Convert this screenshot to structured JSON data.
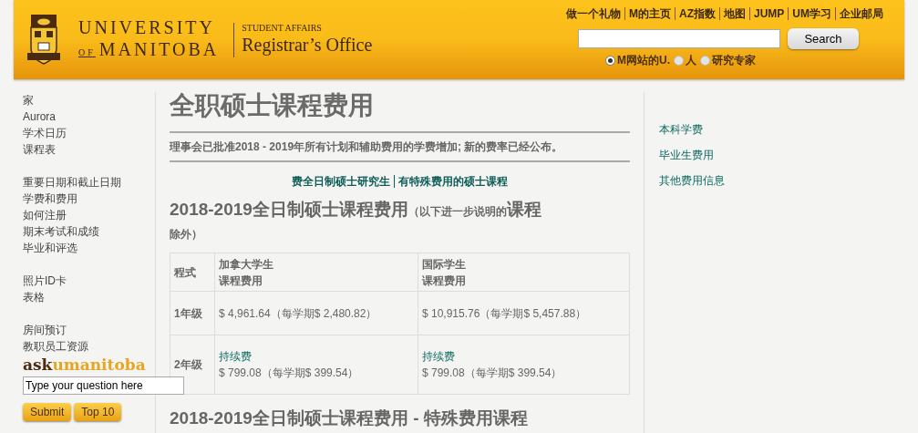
{
  "header": {
    "university_line1": "UNIVERSITY",
    "university_line2_small": "OF",
    "university_line2": "MANITOBA",
    "department": "STUDENT AFFAIRS",
    "office": "Registrar’s Office",
    "top_links": [
      "做一个礼物",
      "M的主页",
      "AZ指数",
      "地图",
      "JUMP",
      "UM学习",
      "企业邮局"
    ],
    "search_button": "Search",
    "search_scopes": [
      {
        "label": "M网站的U.",
        "selected": true
      },
      {
        "label": "人",
        "selected": false
      },
      {
        "label": "研究专家",
        "selected": false
      }
    ]
  },
  "sidebar": {
    "groups": [
      [
        "家",
        "Aurora",
        "学术日历",
        "课程表"
      ],
      [
        "重要日期和截止日期",
        "学费和费用",
        "如何注册",
        "期末考试和成绩",
        "毕业和评选"
      ],
      [
        "照片ID卡",
        "表格"
      ],
      [
        "房间预订",
        "教职员工资源"
      ]
    ],
    "ask_logo": {
      "part1": "ask",
      "part2": "umanitoba"
    },
    "question_field": {
      "value": "Type your question here"
    },
    "buttons": [
      "Submit",
      "Top 10"
    ]
  },
  "main": {
    "title": "全职硕士课程费用",
    "notice": "理事会已批准2018 - 2019年所有计划和辅助费用的学费增加; 新的费率已经公布。",
    "anchor_links": [
      "费全日制硕士研究生",
      "有特殊费用的硕士课程"
    ],
    "section_heading": {
      "text": "2018-2019全日制硕士课程费用",
      "note_before": "（以下进一步说明的",
      "note_emphasis": "课程",
      "note_after": "除外）"
    },
    "table": {
      "columns": [
        {
          "line1": "程式"
        },
        {
          "line1": "加拿大学生",
          "line2": "课程费用"
        },
        {
          "line1": "国际学生",
          "line2": "课程费用"
        }
      ],
      "rows": [
        {
          "cells": [
            {
              "kind": "label",
              "text": "1年级"
            },
            {
              "kind": "fee",
              "amount": "$ 4,961.64（每学期$ 2,480.82）"
            },
            {
              "kind": "fee",
              "amount": "$ 10,915.76（每学期$ 5,457.88）"
            }
          ]
        },
        {
          "cells": [
            {
              "kind": "label",
              "text": "2年级"
            },
            {
              "kind": "fee",
              "link": "持续费",
              "amount": "$ 799.08（每学期$ 399.54）"
            },
            {
              "kind": "fee",
              "link": "持续费",
              "amount": "$ 799.08（每学期$ 399.54）"
            }
          ]
        }
      ]
    },
    "next_heading": "2018-2019全日制硕士课程费用 - 特殊费用课程"
  },
  "right_links": [
    "本科学费",
    "毕业生费用",
    "其他费用信息"
  ]
}
